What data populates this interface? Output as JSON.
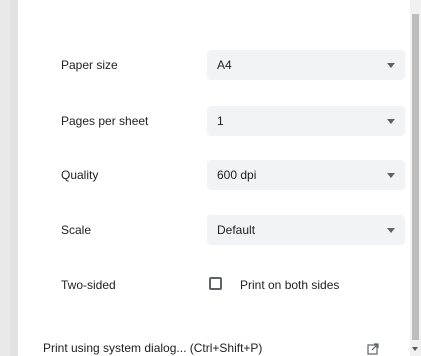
{
  "settings": {
    "paper_size": {
      "label": "Paper size",
      "value": "A4"
    },
    "pages_per_sheet": {
      "label": "Pages per sheet",
      "value": "1"
    },
    "quality": {
      "label": "Quality",
      "value": "600 dpi"
    },
    "scale": {
      "label": "Scale",
      "value": "Default"
    },
    "two_sided": {
      "label": "Two-sided",
      "option_label": "Print on both sides",
      "checked": false
    }
  },
  "system_dialog": {
    "label": "Print using system dialog... (Ctrl+Shift+P)"
  },
  "icons": {
    "dropdown": "chevron-down-icon",
    "external": "open-in-new-icon"
  },
  "colors": {
    "panel_bg": "#ffffff",
    "select_bg": "#f1f3f4",
    "text": "#202124",
    "icon": "#5f6368"
  }
}
